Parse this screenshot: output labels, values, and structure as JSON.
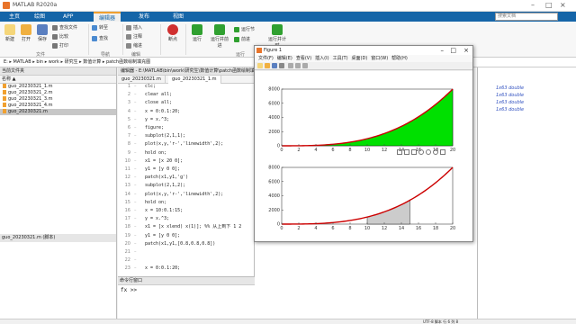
{
  "window": {
    "title": "MATLAB R2020a",
    "controls": [
      "–",
      "□",
      "×"
    ]
  },
  "tabs": [
    "主页",
    "绘图",
    "APP",
    "编辑器",
    "发布",
    "视图"
  ],
  "active_tab_index": 3,
  "search": {
    "placeholder": "搜索文档"
  },
  "ribbon": {
    "file": {
      "new": "新建",
      "open": "打开",
      "save": "保存",
      "section": "文件",
      "find_files": "查找文件",
      "compare": "比较",
      "print": "打印"
    },
    "navigate": {
      "goto": "转至",
      "find": "查找",
      "section": "导航"
    },
    "edit": {
      "insert": "插入",
      "comment": "注释",
      "indent": "缩进",
      "section": "编辑"
    },
    "breakpoints": {
      "label": "断点",
      "section": "断点"
    },
    "run": {
      "run": "运行",
      "run_advance": "运行并前进",
      "run_section": "运行节",
      "advance": "前进",
      "run_time": "运行并计时",
      "section": "运行"
    }
  },
  "address": {
    "path": "E: ▸ MATLAB ▸ bin ▸ work ▸ 研究生 ▸ 数值计算 ▸ patch函数绘制填充图"
  },
  "left_panel": {
    "header": "当前文件夹",
    "col": "名称 ▲",
    "files": [
      "guo_20230321_1.m",
      "guo_20230321_2.m",
      "guo_20230321_3.m",
      "guo_20230321_4.m",
      "guo_20230321.m"
    ],
    "selected_index": 4,
    "detail": "guo_20230321.m (脚本)"
  },
  "editor": {
    "header": "编辑器 - E:\\MATLAB\\bin\\work\\研究生\\数值计算\\patch函数绘制填充图",
    "tabs": [
      "guo_20230321.m",
      "guo_20230321_1.m"
    ],
    "active_tab": 1,
    "lines": [
      {
        "n": "1",
        "t": "clc;"
      },
      {
        "n": "2",
        "t": "clear all;"
      },
      {
        "n": "3",
        "t": "close all;"
      },
      {
        "n": "4",
        "t": "x = 0:0.1:20;"
      },
      {
        "n": "5",
        "t": "y = x.^3;"
      },
      {
        "n": "6",
        "t": "figure;"
      },
      {
        "n": "7",
        "t": "subplot(2,1,1);"
      },
      {
        "n": "8",
        "t": "plot(x,y,'r-','linewidth',2);"
      },
      {
        "n": "9",
        "t": "hold on;"
      },
      {
        "n": "10",
        "t": "x1 = [x 20 0];"
      },
      {
        "n": "11",
        "t": "y1 = [y 0 0];"
      },
      {
        "n": "12",
        "t": "patch(x1,y1,'g')"
      },
      {
        "n": "13",
        "t": "subplot(2,1,2);"
      },
      {
        "n": "14",
        "t": "plot(x,y,'r-','linewidth',2);"
      },
      {
        "n": "15",
        "t": "hold on;"
      },
      {
        "n": "16",
        "t": "x = 10:0.1:15;"
      },
      {
        "n": "17",
        "t": "y = x.^3;"
      },
      {
        "n": "18",
        "t": "x1 = [x xlend) x(1)]; %% 从上到下 1 2"
      },
      {
        "n": "19",
        "t": "y1 = [y 0 0];"
      },
      {
        "n": "20",
        "t": "patch(x1,y1,[0.8,0.8,0.8])"
      },
      {
        "n": "21",
        "t": ""
      },
      {
        "n": "22",
        "t": ""
      },
      {
        "n": "23",
        "t": "x = 0:0.1:20;"
      }
    ]
  },
  "command_window": {
    "header": "命令行窗口",
    "prompt": "fx >>"
  },
  "workspace": {
    "values": [
      "1x63 double",
      "1x63 double",
      "1x63 double",
      "1x63 double"
    ]
  },
  "figure": {
    "title": "Figure 1",
    "menu": [
      "文件(F)",
      "编辑(E)",
      "查看(V)",
      "插入(I)",
      "工具(T)",
      "桌面(D)",
      "窗口(W)",
      "帮助(H)"
    ]
  },
  "chart_data": [
    {
      "type": "area",
      "title": "",
      "xlim": [
        0,
        20
      ],
      "ylim": [
        0,
        8000
      ],
      "xticks": [
        0,
        2,
        4,
        6,
        8,
        10,
        12,
        14,
        16,
        18,
        20
      ],
      "yticks": [
        0,
        2000,
        4000,
        6000,
        8000
      ],
      "curve": "y = x^3",
      "line_color": "#cc0000",
      "fill_color": "#00e000",
      "fill_range": [
        0,
        20
      ]
    },
    {
      "type": "area",
      "title": "",
      "xlim": [
        0,
        20
      ],
      "ylim": [
        0,
        8000
      ],
      "xticks": [
        0,
        2,
        4,
        6,
        8,
        10,
        12,
        14,
        16,
        18,
        20
      ],
      "yticks": [
        0,
        2000,
        4000,
        6000,
        8000
      ],
      "curve": "y = x^3",
      "line_color": "#cc0000",
      "fill_color": "#cccccc",
      "fill_range": [
        10,
        15
      ]
    }
  ],
  "status": {
    "text": "UTF-8   脚本   行 6  列 8"
  }
}
